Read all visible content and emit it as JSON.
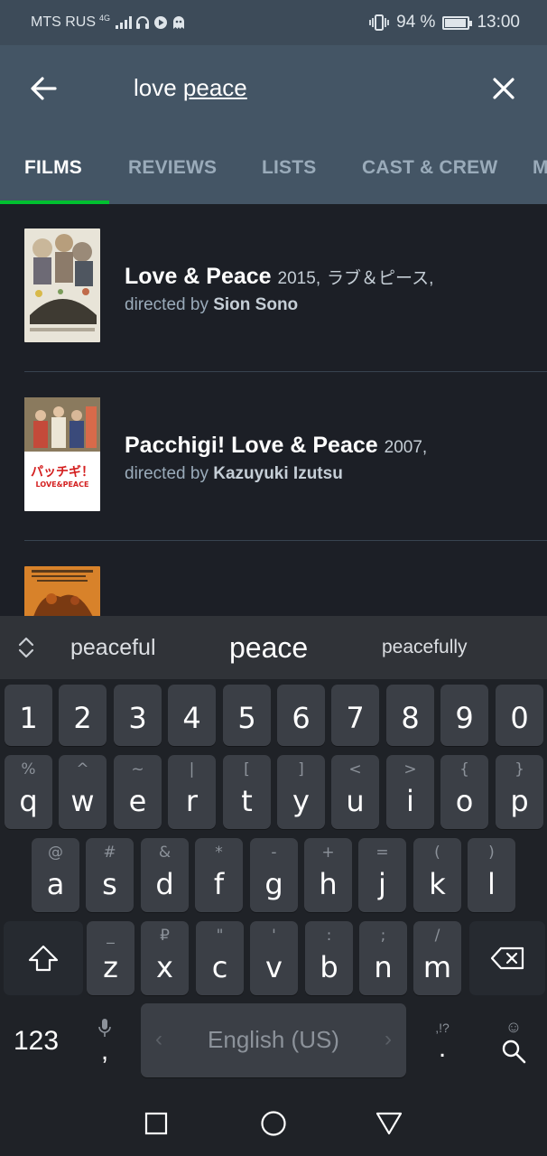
{
  "status_bar": {
    "carrier": "MTS RUS",
    "network": "4G",
    "battery": "94 %",
    "battery_level": 0.94,
    "time": "13:00"
  },
  "search": {
    "query_start": "love ",
    "query_current": "peace"
  },
  "tabs": [
    {
      "label": "FILMS",
      "active": true
    },
    {
      "label": "REVIEWS",
      "active": false
    },
    {
      "label": "LISTS",
      "active": false
    },
    {
      "label": "CAST & CREW",
      "active": false
    },
    {
      "label": "M",
      "active": false
    }
  ],
  "results": [
    {
      "title": "Love & Peace",
      "year": "2015,",
      "alt_title": "ラブ＆ピース,",
      "directed_by_label": "directed by",
      "director": "Sion Sono"
    },
    {
      "title": "Pacchigi! Love & Peace",
      "year": "2007,",
      "alt_title": "",
      "poster_text_1": "パッチギ！",
      "poster_text_2": "LOVE&PEACE",
      "directed_by_label": "directed by",
      "director": "Kazuyuki Izutsu"
    }
  ],
  "suggestions": [
    "peaceful",
    "peace",
    "peacefully"
  ],
  "keyboard": {
    "numbers": [
      "1",
      "2",
      "3",
      "4",
      "5",
      "6",
      "7",
      "8",
      "9",
      "0"
    ],
    "row1": [
      {
        "k": "q",
        "s": "%"
      },
      {
        "k": "w",
        "s": "^"
      },
      {
        "k": "e",
        "s": "~"
      },
      {
        "k": "r",
        "s": "|"
      },
      {
        "k": "t",
        "s": "["
      },
      {
        "k": "y",
        "s": "]"
      },
      {
        "k": "u",
        "s": "<"
      },
      {
        "k": "i",
        "s": ">"
      },
      {
        "k": "o",
        "s": "{"
      },
      {
        "k": "p",
        "s": "}"
      }
    ],
    "row2": [
      {
        "k": "a",
        "s": "@"
      },
      {
        "k": "s",
        "s": "#"
      },
      {
        "k": "d",
        "s": "&"
      },
      {
        "k": "f",
        "s": "*"
      },
      {
        "k": "g",
        "s": "-"
      },
      {
        "k": "h",
        "s": "+"
      },
      {
        "k": "j",
        "s": "="
      },
      {
        "k": "k",
        "s": "("
      },
      {
        "k": "l",
        "s": ")"
      }
    ],
    "row3": [
      {
        "k": "z",
        "s": "_"
      },
      {
        "k": "x",
        "s": "₽"
      },
      {
        "k": "c",
        "s": "\""
      },
      {
        "k": "v",
        "s": "'"
      },
      {
        "k": "b",
        "s": ":"
      },
      {
        "k": "n",
        "s": ";"
      },
      {
        "k": "m",
        "s": "/"
      }
    ],
    "numbers_key": "123",
    "comma_key": ",",
    "space_label": "English (US)",
    "punct_hint": ",!?",
    "period_key": "."
  },
  "colors": {
    "header_bg": "#445565",
    "accent": "#00c030",
    "content_bg": "#1c1f26"
  }
}
